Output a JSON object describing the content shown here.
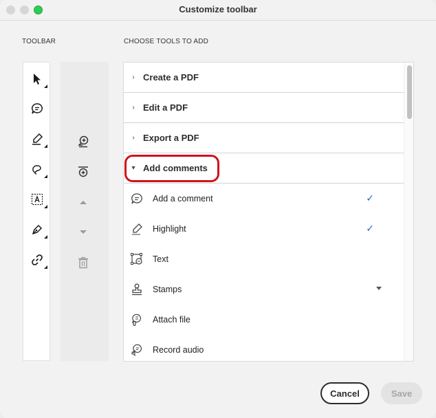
{
  "window": {
    "title": "Customize toolbar"
  },
  "labels": {
    "toolbar": "TOOLBAR",
    "choose": "CHOOSE TOOLS TO ADD"
  },
  "toolbar_icons": [
    "select-icon",
    "comment-icon",
    "highlight-icon",
    "draw-loop-icon",
    "text-box-icon",
    "fill-sign-icon",
    "link-icon"
  ],
  "action_icons": [
    "add-tool-icon",
    "add-separator-icon",
    "move-up-icon",
    "move-down-icon",
    "delete-icon"
  ],
  "categories": [
    {
      "label": "Create a PDF",
      "expanded": false
    },
    {
      "label": "Edit a PDF",
      "expanded": false
    },
    {
      "label": "Export a PDF",
      "expanded": false
    },
    {
      "label": "Add comments",
      "expanded": true
    }
  ],
  "tools": [
    {
      "label": "Add a comment",
      "icon": "comment-icon",
      "checked": true
    },
    {
      "label": "Highlight",
      "icon": "highlight-icon",
      "checked": true
    },
    {
      "label": "Text",
      "icon": "text-icon",
      "checked": false
    },
    {
      "label": "Stamps",
      "icon": "stamp-icon",
      "checked": false,
      "dropdown": true
    },
    {
      "label": "Attach file",
      "icon": "attach-file-icon",
      "checked": false
    },
    {
      "label": "Record audio",
      "icon": "record-audio-icon",
      "checked": false
    }
  ],
  "buttons": {
    "cancel": "Cancel",
    "save": "Save"
  },
  "colors": {
    "highlight_ring": "#d0121b",
    "check": "#1b6ad4",
    "window_bg": "#f2f2f2"
  }
}
